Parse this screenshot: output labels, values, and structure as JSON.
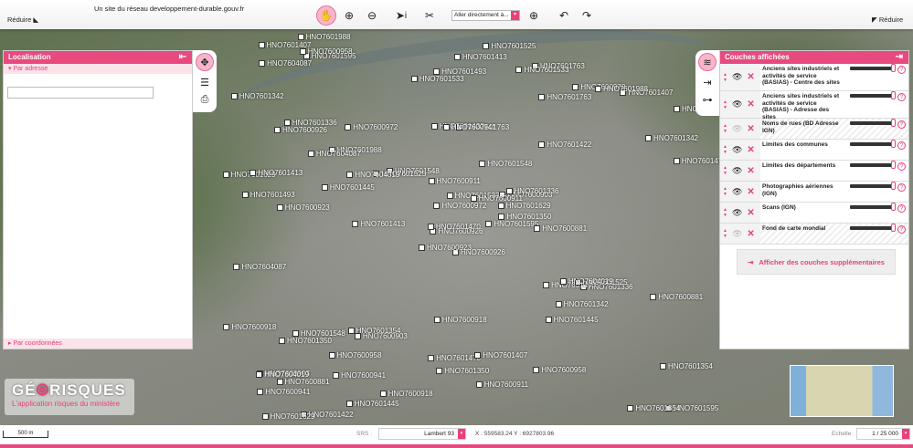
{
  "header": {
    "site_link": "Un site du réseau developpement-durable.gouv.fr",
    "reduce_left": "Réduire",
    "reduce_right": "Réduire",
    "goto_placeholder": "Aller directement à...",
    "tools": [
      "pan-icon",
      "zoom-in-icon",
      "zoom-out-icon",
      "info-icon",
      "measure-icon",
      "globe-icon",
      "undo-icon",
      "redo-icon"
    ]
  },
  "left_panel": {
    "title": "Localisation",
    "by_address": "Par adresse",
    "address_value": "",
    "by_coordinates": "Par coordonnées"
  },
  "right_panel": {
    "title": "Couches affichées",
    "layers": [
      {
        "name": "Anciens sites industriels et activités de service (BASIAS) - Centre des sites",
        "visible": true,
        "opacity": 1
      },
      {
        "name": "Anciens sites industriels et activités de service (BASIAS) - Adresse des sites",
        "visible": true,
        "opacity": 1
      },
      {
        "name": "Noms de rues (BD Adresse IGN)",
        "visible": false,
        "opacity": 1
      },
      {
        "name": "Limites des communes",
        "visible": true,
        "opacity": 1
      },
      {
        "name": "Limites des départements",
        "visible": true,
        "opacity": 1
      },
      {
        "name": "Photographies aériennes (IGN)",
        "visible": true,
        "opacity": 1
      },
      {
        "name": "Scans (IGN)",
        "visible": true,
        "opacity": 1
      },
      {
        "name": "Fond de carte mondial",
        "visible": false,
        "opacity": 1
      }
    ],
    "more_layers": "Afficher des couches supplémentaires"
  },
  "map": {
    "labels": [
      "HNO7600926",
      "HNO7600903",
      "HNO7601763",
      "HNO7601595",
      "HNO7600923",
      "HNO7601422",
      "HNO7601548",
      "HNO7600941",
      "HNO7601336",
      "HNO7601493",
      "HNO7601470",
      "HNO7600972",
      "HNO7601354",
      "HNO7601525",
      "HNO7601445",
      "HNO7601629",
      "HNO7601350",
      "HNO7601342",
      "HNO7600958",
      "HNO7601407",
      "HNO7601413",
      "HNO7601988",
      "HNO7601533",
      "HNO7600918",
      "HNO7604019",
      "HNO7604087",
      "HNO7600911",
      "HNO7600881"
    ]
  },
  "logo": {
    "title_a": "GÉ",
    "title_b": "RISQUES",
    "subtitle": "L'application risques du ministère"
  },
  "footer": {
    "scale": "500 m",
    "srs_label": "SRS :",
    "srs_value": "Lambert 93",
    "coords": "X : 559583.24 Y : 6927803.96",
    "scale_label": "Echelle :",
    "scale_value": "1 / 25 000"
  },
  "colors": {
    "accent": "#e84a7f"
  }
}
